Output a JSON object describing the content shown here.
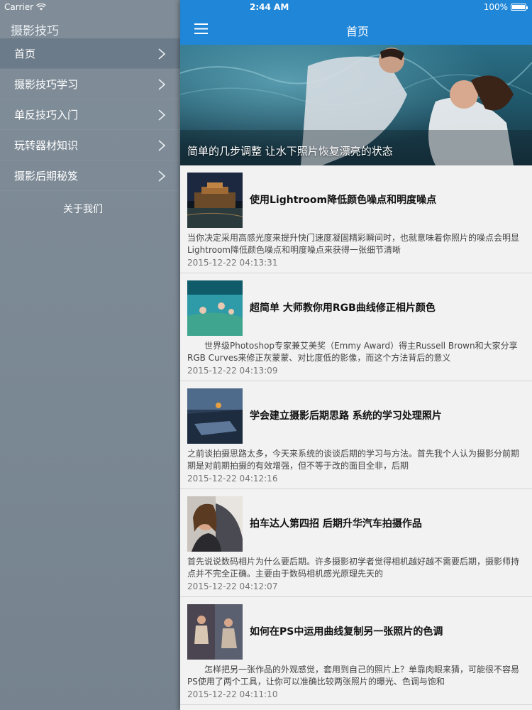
{
  "status": {
    "carrier": "Carrier",
    "time": "2:44 AM",
    "battery": "100%"
  },
  "sidebar": {
    "title": "摄影技巧",
    "items": [
      {
        "label": "首页"
      },
      {
        "label": "摄影技巧学习"
      },
      {
        "label": "单反技巧入门"
      },
      {
        "label": "玩转器材知识"
      },
      {
        "label": "摄影后期秘笈"
      }
    ],
    "about": "关于我们"
  },
  "header": {
    "title": "首页",
    "icon": "menu-icon"
  },
  "hero": {
    "caption": "简单的几步调整 让水下照片恢复漂亮的状态"
  },
  "articles": [
    {
      "title": "使用Lightroom降低颜色噪点和明度噪点",
      "summary1": "当你决定采用高感光度来提升快门速度凝固精彩瞬间时，也就意味着你照片的噪点会明显",
      "summary2": "Lightroom降低颜色噪点和明度噪点来获得一张细节清晰",
      "date": "2015-12-22 04:13:31"
    },
    {
      "title": "超简单 大师教你用RGB曲线修正相片颜色",
      "summary1": "　　世界级Photoshop专家兼艾美奖（Emmy Award）得主Russell Brown和大家分享",
      "summary2": "RGB Curves来修正灰蒙蒙、对比度低的影像，而这个方法背后的意义",
      "date": "2015-12-22 04:13:09"
    },
    {
      "title": "学会建立摄影后期思路 系统的学习处理照片",
      "summary1": "之前谈拍摄思路太多，今天来系统的谈谈后期的学习与方法。首先我个人认为摄影分前期",
      "summary2": "期是对前期拍摄的有效增强，但不等于改的面目全非，后期",
      "date": "2015-12-22 04:12:16"
    },
    {
      "title": "拍车达人第四招 后期升华汽车拍摄作品",
      "summary1": "首先说说数码相片为什么要后期。许多摄影初学者觉得相机越好越不需要后期，摄影师持",
      "summary2": "点并不完全正确。主要由于数码相机感光原理先天的",
      "date": "2015-12-22 04:12:07"
    },
    {
      "title": "如何在PS中运用曲线复制另一张照片的色调",
      "summary1": "　　怎样把另一张作品的外观感觉，套用到自己的照片上？单靠肉眼来猜，可能很不容易",
      "summary2": "PS使用了两个工具，让你可以准确比较两张照片的曝光、色调与饱和",
      "date": "2015-12-22 04:11:10"
    }
  ]
}
